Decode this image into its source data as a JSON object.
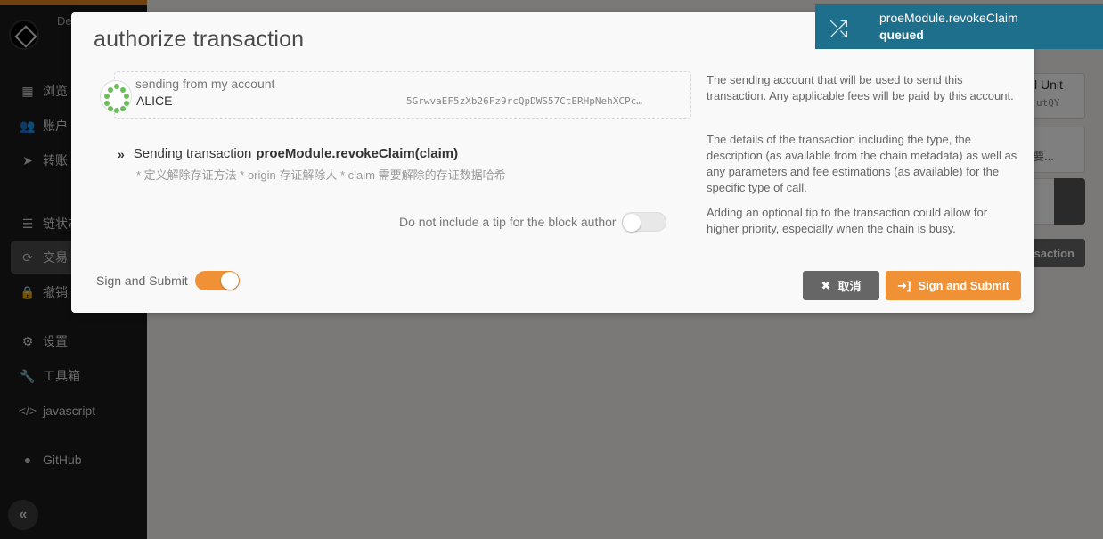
{
  "sidebar": {
    "brand": "De",
    "items": [
      {
        "label": "浏览",
        "icon": "grid-icon"
      },
      {
        "label": "账户",
        "icon": "users-icon"
      },
      {
        "label": "转账",
        "icon": "send-icon"
      },
      {
        "label": "链状态",
        "icon": "database-icon"
      },
      {
        "label": "交易",
        "icon": "sync-icon"
      },
      {
        "label": "撤销",
        "icon": "lock-icon"
      },
      {
        "label": "设置",
        "icon": "gears-icon"
      },
      {
        "label": "工具箱",
        "icon": "wrench-icon"
      },
      {
        "label": "javascript",
        "icon": "code-icon"
      },
      {
        "label": "GitHub",
        "icon": "github-icon"
      }
    ],
    "collapse_icon": "double-chevron-left-icon"
  },
  "background": {
    "unit_label": "l Unit",
    "unit_value": "utQY",
    "dropdown2_value": "要...",
    "submit_label": "saction"
  },
  "modal": {
    "title": "authorize transaction",
    "account": {
      "label": "sending from my account",
      "name": "ALICE",
      "address": "5GrwvaEF5zXb26Fz9rcQpDWS57CtERHpNehXCPc…"
    },
    "transaction": {
      "prefix": "Sending transaction",
      "method": "proeModule.revokeClaim(claim)",
      "description": "* 定义解除存证方法 * origin 存证解除人 * claim 需要解除的存证数据哈希"
    },
    "tip": {
      "label": "Do not include a tip for the block author",
      "enabled": false
    },
    "help": {
      "account": "The sending account that will be used to send this transaction. Any applicable fees will be paid by this account.",
      "details": "The details of the transaction including the type, the description (as available from the chain metadata) as well as any parameters and fee estimations (as available) for the specific type of call.",
      "tip": "Adding an optional tip to the transaction could allow for higher priority, especially when the chain is busy."
    },
    "sign": {
      "label": "Sign and Submit",
      "enabled": true
    },
    "buttons": {
      "cancel": "取消",
      "submit": "Sign and Submit"
    }
  },
  "notification": {
    "title": "proeModule.revokeClaim",
    "status": "queued"
  },
  "colors": {
    "accent": "#f19135",
    "sidebar_bg": "#1a1a1a",
    "notification_bg": "#1e6f8c"
  }
}
